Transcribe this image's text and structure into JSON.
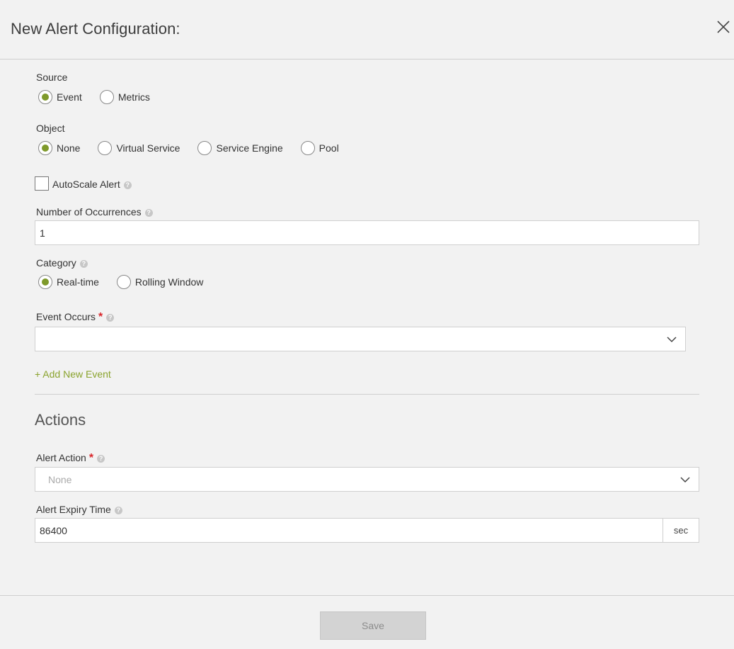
{
  "header": {
    "title": "New Alert Configuration:"
  },
  "source": {
    "label": "Source",
    "options": [
      "Event",
      "Metrics"
    ],
    "selected": "Event"
  },
  "object": {
    "label": "Object",
    "options": [
      "None",
      "Virtual Service",
      "Service Engine",
      "Pool"
    ],
    "selected": "None"
  },
  "autoscale": {
    "label": "AutoScale Alert",
    "checked": false
  },
  "occurrences": {
    "label": "Number of Occurrences",
    "value": "1"
  },
  "category": {
    "label": "Category",
    "options": [
      "Real-time",
      "Rolling Window"
    ],
    "selected": "Real-time"
  },
  "event_occurs": {
    "label": "Event Occurs",
    "required_mark": "*",
    "value": ""
  },
  "add_event": {
    "label": "+ Add New Event"
  },
  "actions": {
    "title": "Actions",
    "alert_action": {
      "label": "Alert Action",
      "required_mark": "*",
      "placeholder": "None"
    },
    "expiry": {
      "label": "Alert Expiry Time",
      "value": "86400",
      "unit": "sec"
    }
  },
  "footer": {
    "save_label": "Save"
  },
  "colors": {
    "accent": "#7f9a2b",
    "required": "#d9262b",
    "link": "#8aa32d"
  },
  "icons": {
    "close": "close-icon",
    "chevron": "chevron-down-icon",
    "help": "help-icon"
  }
}
